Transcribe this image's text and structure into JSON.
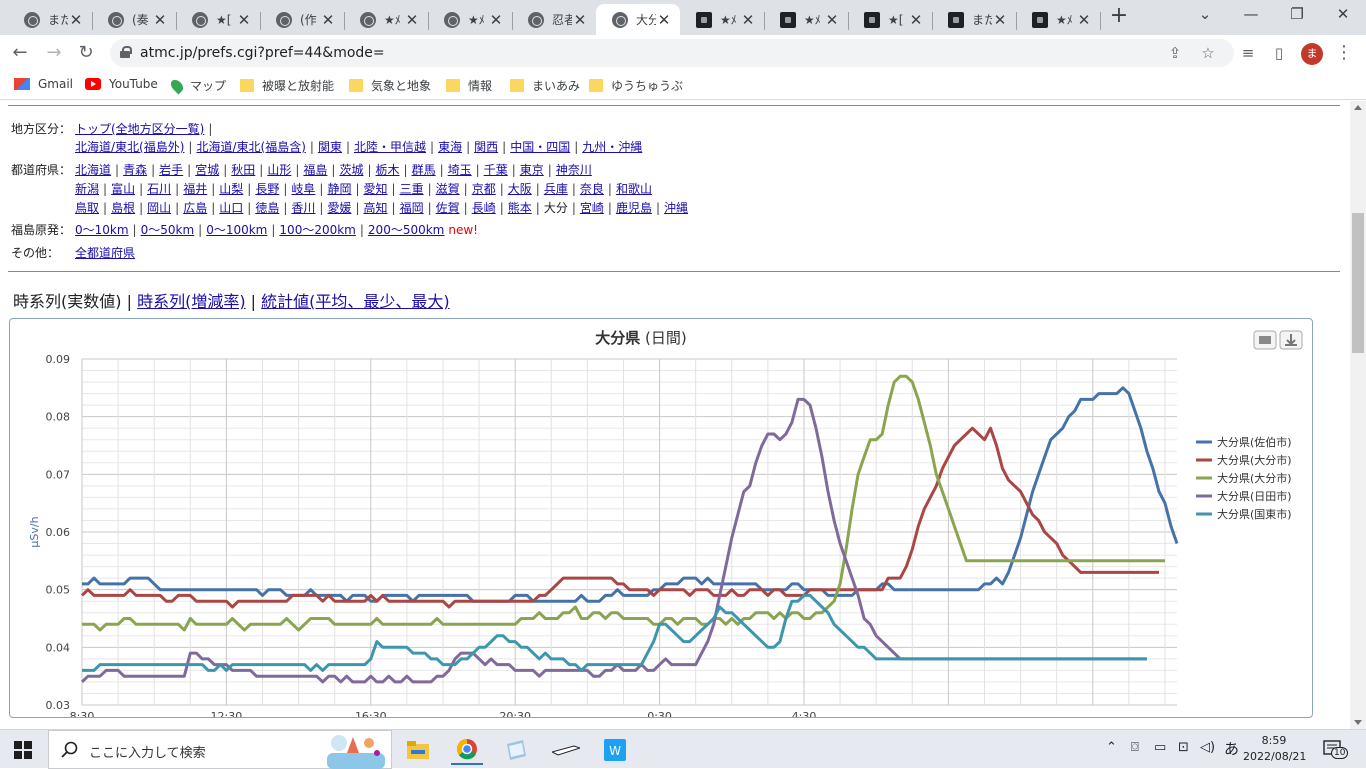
{
  "tabs": [
    {
      "title": "また",
      "icon": "globe"
    },
    {
      "title": "(奏",
      "icon": "globe"
    },
    {
      "title": "★[",
      "icon": "globe"
    },
    {
      "title": "(作",
      "icon": "globe"
    },
    {
      "title": "★ﾒ",
      "icon": "globe"
    },
    {
      "title": "★ﾒ",
      "icon": "globe"
    },
    {
      "title": "忍者",
      "icon": "globe"
    },
    {
      "title": "大分",
      "icon": "globe",
      "active": true
    },
    {
      "title": "★ﾒ",
      "icon": "site"
    },
    {
      "title": "★ﾒ",
      "icon": "site"
    },
    {
      "title": "★[",
      "icon": "site"
    },
    {
      "title": "また",
      "icon": "site"
    },
    {
      "title": "★ﾒ",
      "icon": "site"
    }
  ],
  "new_tab": "+",
  "window": {
    "minimize": "⌄",
    "restore": "—",
    "maximize": "❐",
    "close": "✕"
  },
  "toolbar": {
    "back": "←",
    "forward": "→",
    "reload": "↻",
    "url": "atmc.jp/prefs.cgi?pref=44&mode=",
    "share": "⇪",
    "star": "☆",
    "media": "≡",
    "sidepanel": "▯",
    "menu": "⋮",
    "avatar": "ま"
  },
  "bookmarks": [
    {
      "label": "Gmail",
      "type": "gmail"
    },
    {
      "label": "YouTube",
      "type": "youtube"
    },
    {
      "label": "マップ",
      "type": "maps"
    },
    {
      "label": "被曝と放射能",
      "type": "folder"
    },
    {
      "label": "気象と地象",
      "type": "folder"
    },
    {
      "label": "情報",
      "type": "folder"
    },
    {
      "label": "まいあみ",
      "type": "folder"
    },
    {
      "label": "ゆうちゅうぶ",
      "type": "folder"
    }
  ],
  "nav": {
    "region_label": "地方区分：",
    "region_top": "トップ(全地方区分一覧)",
    "regions_row1": [
      "北海道/東北(福島外)",
      "北海道/東北(福島含)",
      "関東",
      "北陸・甲信越",
      "東海",
      "関西",
      "中国・四国",
      "九州・沖縄"
    ],
    "pref_label": "都道府県：",
    "prefs_row1": [
      "北海道",
      "青森",
      "岩手",
      "宮城",
      "秋田",
      "山形",
      "福島",
      "茨城",
      "栃木",
      "群馬",
      "埼玉",
      "千葉",
      "東京",
      "神奈川"
    ],
    "prefs_row2": [
      "新潟",
      "富山",
      "石川",
      "福井",
      "山梨",
      "長野",
      "岐阜",
      "静岡",
      "愛知",
      "三重",
      "滋賀",
      "京都",
      "大阪",
      "兵庫",
      "奈良",
      "和歌山"
    ],
    "prefs_row3": [
      "鳥取",
      "島根",
      "岡山",
      "広島",
      "山口",
      "徳島",
      "香川",
      "愛媛",
      "高知",
      "福岡",
      "佐賀",
      "長崎",
      "熊本",
      "大分",
      "宮崎",
      "鹿児島",
      "沖縄"
    ],
    "current_pref": "大分",
    "fukushima_label": "福島原発：",
    "fukushima_links": [
      "0〜10km",
      "0〜50km",
      "0〜100km",
      "100〜200km",
      "200〜500km"
    ],
    "new_tag": "new!",
    "other_label": "その他：",
    "other_link": "全都道府県"
  },
  "view_tabs": {
    "current": "時系列(実数値)",
    "link1": "時系列(増減率)",
    "link2": "統計値(平均、最少、最大)",
    "sep": "|"
  },
  "chart_data": {
    "type": "line",
    "title": "大分県",
    "subtitle": "(日間)",
    "ylabel": "μSv/h",
    "ylim": [
      0.03,
      0.09
    ],
    "yticks": [
      "0.03",
      "0.04",
      "0.05",
      "0.06",
      "0.07",
      "0.08",
      "0.09"
    ],
    "xlabels": [
      "8:30",
      "12:30",
      "16:30",
      "20:30",
      "0:30",
      "4:30"
    ],
    "x_start": "8:30",
    "interval_minutes": 10,
    "legend_position": "right",
    "grid": true,
    "series": [
      {
        "name": "大分県(佐伯市)",
        "color": "#4572a7",
        "values": [
          0.051,
          0.051,
          0.052,
          0.051,
          0.051,
          0.051,
          0.051,
          0.051,
          0.052,
          0.052,
          0.052,
          0.052,
          0.051,
          0.05,
          0.05,
          0.05,
          0.05,
          0.05,
          0.05,
          0.05,
          0.05,
          0.05,
          0.05,
          0.05,
          0.05,
          0.05,
          0.05,
          0.05,
          0.05,
          0.05,
          0.049,
          0.05,
          0.05,
          0.05,
          0.049,
          0.049,
          0.049,
          0.049,
          0.05,
          0.049,
          0.049,
          0.049,
          0.049,
          0.049,
          0.048,
          0.049,
          0.049,
          0.049,
          0.048,
          0.048,
          0.049,
          0.049,
          0.049,
          0.049,
          0.049,
          0.048,
          0.049,
          0.049,
          0.049,
          0.049,
          0.049,
          0.049,
          0.049,
          0.049,
          0.049,
          0.048,
          0.048,
          0.048,
          0.048,
          0.048,
          0.048,
          0.048,
          0.049,
          0.049,
          0.049,
          0.048,
          0.048,
          0.048,
          0.048,
          0.048,
          0.048,
          0.048,
          0.048,
          0.049,
          0.048,
          0.048,
          0.048,
          0.049,
          0.049,
          0.05,
          0.049,
          0.049,
          0.049,
          0.049,
          0.049,
          0.05,
          0.05,
          0.051,
          0.051,
          0.051,
          0.052,
          0.052,
          0.052,
          0.051,
          0.052,
          0.051,
          0.051,
          0.051,
          0.051,
          0.051,
          0.051,
          0.051,
          0.051,
          0.05,
          0.05,
          0.05,
          0.05,
          0.05,
          0.051,
          0.051,
          0.05,
          0.05,
          0.05,
          0.05,
          0.049,
          0.049,
          0.049,
          0.049,
          0.049,
          0.05,
          0.05,
          0.05,
          0.05,
          0.051,
          0.051,
          0.05,
          0.05,
          0.05,
          0.05,
          0.05,
          0.05,
          0.05,
          0.05,
          0.05,
          0.05,
          0.05,
          0.05,
          0.05,
          0.05,
          0.05,
          0.051,
          0.051,
          0.052,
          0.051,
          0.053,
          0.056,
          0.059,
          0.063,
          0.067,
          0.07,
          0.073,
          0.076,
          0.077,
          0.078,
          0.08,
          0.081,
          0.083,
          0.083,
          0.083,
          0.084,
          0.084,
          0.084,
          0.084,
          0.085,
          0.084,
          0.081,
          0.078,
          0.074,
          0.071,
          0.067,
          0.065,
          0.061,
          0.058
        ]
      },
      {
        "name": "大分県(大分市)",
        "color": "#aa4643",
        "values": [
          0.049,
          0.05,
          0.049,
          0.049,
          0.049,
          0.049,
          0.049,
          0.049,
          0.05,
          0.049,
          0.049,
          0.049,
          0.049,
          0.049,
          0.048,
          0.048,
          0.049,
          0.049,
          0.049,
          0.048,
          0.048,
          0.048,
          0.048,
          0.048,
          0.048,
          0.047,
          0.048,
          0.048,
          0.048,
          0.048,
          0.048,
          0.048,
          0.048,
          0.048,
          0.048,
          0.049,
          0.049,
          0.049,
          0.049,
          0.049,
          0.048,
          0.049,
          0.048,
          0.048,
          0.048,
          0.048,
          0.048,
          0.048,
          0.049,
          0.048,
          0.049,
          0.048,
          0.048,
          0.048,
          0.048,
          0.048,
          0.048,
          0.048,
          0.048,
          0.048,
          0.048,
          0.047,
          0.048,
          0.048,
          0.048,
          0.048,
          0.048,
          0.048,
          0.048,
          0.048,
          0.048,
          0.048,
          0.048,
          0.048,
          0.048,
          0.048,
          0.049,
          0.049,
          0.05,
          0.051,
          0.052,
          0.052,
          0.052,
          0.052,
          0.052,
          0.052,
          0.052,
          0.052,
          0.052,
          0.051,
          0.051,
          0.05,
          0.05,
          0.05,
          0.05,
          0.049,
          0.05,
          0.05,
          0.05,
          0.05,
          0.05,
          0.049,
          0.05,
          0.05,
          0.05,
          0.049,
          0.049,
          0.049,
          0.05,
          0.049,
          0.049,
          0.05,
          0.05,
          0.05,
          0.049,
          0.05,
          0.05,
          0.049,
          0.049,
          0.049,
          0.049,
          0.05,
          0.05,
          0.05,
          0.05,
          0.05,
          0.05,
          0.05,
          0.05,
          0.05,
          0.05,
          0.05,
          0.05,
          0.05,
          0.052,
          0.052,
          0.052,
          0.054,
          0.057,
          0.061,
          0.064,
          0.066,
          0.068,
          0.071,
          0.073,
          0.075,
          0.076,
          0.077,
          0.078,
          0.077,
          0.076,
          0.078,
          0.075,
          0.071,
          0.069,
          0.068,
          0.067,
          0.065,
          0.063,
          0.062,
          0.06,
          0.059,
          0.058,
          0.056,
          0.055,
          0.054,
          0.053,
          0.053,
          0.053,
          0.053,
          0.053,
          0.053,
          0.053,
          0.053,
          0.053,
          0.053,
          0.053,
          0.053,
          0.053,
          0.053
        ]
      },
      {
        "name": "大分県(大分市)",
        "color": "#89a54e",
        "values": [
          0.044,
          0.044,
          0.044,
          0.043,
          0.044,
          0.044,
          0.044,
          0.045,
          0.045,
          0.044,
          0.044,
          0.044,
          0.044,
          0.044,
          0.044,
          0.044,
          0.044,
          0.043,
          0.045,
          0.044,
          0.044,
          0.044,
          0.044,
          0.044,
          0.044,
          0.045,
          0.044,
          0.043,
          0.044,
          0.044,
          0.044,
          0.044,
          0.044,
          0.044,
          0.045,
          0.044,
          0.043,
          0.044,
          0.045,
          0.045,
          0.045,
          0.045,
          0.044,
          0.044,
          0.044,
          0.044,
          0.044,
          0.044,
          0.044,
          0.045,
          0.044,
          0.044,
          0.044,
          0.044,
          0.044,
          0.044,
          0.044,
          0.044,
          0.044,
          0.045,
          0.044,
          0.044,
          0.044,
          0.044,
          0.044,
          0.044,
          0.044,
          0.044,
          0.044,
          0.044,
          0.044,
          0.044,
          0.044,
          0.045,
          0.045,
          0.045,
          0.046,
          0.045,
          0.045,
          0.045,
          0.046,
          0.046,
          0.047,
          0.045,
          0.045,
          0.046,
          0.046,
          0.045,
          0.046,
          0.046,
          0.045,
          0.045,
          0.045,
          0.045,
          0.045,
          0.044,
          0.044,
          0.045,
          0.045,
          0.044,
          0.045,
          0.045,
          0.045,
          0.044,
          0.044,
          0.045,
          0.045,
          0.044,
          0.045,
          0.044,
          0.045,
          0.045,
          0.046,
          0.046,
          0.046,
          0.045,
          0.046,
          0.045,
          0.046,
          0.046,
          0.045,
          0.045,
          0.046,
          0.046,
          0.047,
          0.048,
          0.051,
          0.057,
          0.064,
          0.07,
          0.073,
          0.076,
          0.076,
          0.077,
          0.082,
          0.086,
          0.087,
          0.087,
          0.086,
          0.083,
          0.079,
          0.075,
          0.07,
          0.067,
          0.064,
          0.061,
          0.058,
          0.055,
          0.055,
          0.055,
          0.055,
          0.055,
          0.055,
          0.055,
          0.055,
          0.055,
          0.055,
          0.055,
          0.055,
          0.055,
          0.055,
          0.055,
          0.055,
          0.055,
          0.055,
          0.055,
          0.055,
          0.055,
          0.055,
          0.055,
          0.055,
          0.055,
          0.055,
          0.055,
          0.055,
          0.055,
          0.055,
          0.055,
          0.055,
          0.055,
          0.055
        ]
      },
      {
        "name": "大分県(日田市)",
        "color": "#80699b",
        "values": [
          0.034,
          0.035,
          0.035,
          0.035,
          0.036,
          0.036,
          0.036,
          0.035,
          0.035,
          0.035,
          0.035,
          0.035,
          0.035,
          0.035,
          0.035,
          0.035,
          0.035,
          0.035,
          0.039,
          0.039,
          0.038,
          0.038,
          0.037,
          0.037,
          0.037,
          0.036,
          0.036,
          0.036,
          0.036,
          0.035,
          0.035,
          0.035,
          0.035,
          0.035,
          0.035,
          0.035,
          0.035,
          0.035,
          0.035,
          0.035,
          0.034,
          0.035,
          0.035,
          0.034,
          0.035,
          0.034,
          0.034,
          0.034,
          0.035,
          0.034,
          0.034,
          0.035,
          0.034,
          0.034,
          0.035,
          0.034,
          0.034,
          0.034,
          0.034,
          0.035,
          0.035,
          0.036,
          0.038,
          0.039,
          0.039,
          0.039,
          0.038,
          0.037,
          0.038,
          0.037,
          0.037,
          0.037,
          0.036,
          0.036,
          0.036,
          0.036,
          0.035,
          0.036,
          0.036,
          0.036,
          0.036,
          0.036,
          0.036,
          0.036,
          0.036,
          0.035,
          0.035,
          0.036,
          0.036,
          0.037,
          0.036,
          0.036,
          0.036,
          0.037,
          0.036,
          0.036,
          0.037,
          0.038,
          0.037,
          0.037,
          0.037,
          0.037,
          0.037,
          0.039,
          0.041,
          0.044,
          0.049,
          0.054,
          0.059,
          0.063,
          0.067,
          0.068,
          0.072,
          0.075,
          0.077,
          0.077,
          0.076,
          0.077,
          0.079,
          0.083,
          0.083,
          0.082,
          0.078,
          0.073,
          0.067,
          0.062,
          0.058,
          0.055,
          0.052,
          0.049,
          0.045,
          0.044,
          0.042,
          0.041,
          0.04,
          0.039,
          0.038,
          0.038,
          0.038,
          0.038,
          0.038,
          0.038,
          0.038,
          0.038,
          0.038,
          0.038,
          0.038,
          0.038,
          0.038,
          0.038,
          0.038,
          0.038,
          0.038,
          0.038,
          0.038,
          0.038,
          0.038,
          0.038,
          0.038,
          0.038,
          0.038,
          0.038,
          0.038,
          0.038,
          0.038,
          0.038,
          0.038,
          0.038,
          0.038,
          0.038,
          0.038,
          0.038,
          0.038,
          0.038,
          0.038,
          0.038,
          0.038,
          0.038
        ]
      },
      {
        "name": "大分県(国東市)",
        "color": "#3d96ae",
        "values": [
          0.036,
          0.036,
          0.036,
          0.037,
          0.037,
          0.037,
          0.037,
          0.037,
          0.037,
          0.037,
          0.037,
          0.037,
          0.037,
          0.037,
          0.037,
          0.037,
          0.037,
          0.037,
          0.037,
          0.037,
          0.037,
          0.036,
          0.036,
          0.037,
          0.036,
          0.037,
          0.037,
          0.037,
          0.037,
          0.037,
          0.037,
          0.037,
          0.037,
          0.037,
          0.037,
          0.037,
          0.037,
          0.037,
          0.036,
          0.037,
          0.036,
          0.037,
          0.037,
          0.037,
          0.037,
          0.037,
          0.037,
          0.037,
          0.038,
          0.041,
          0.04,
          0.04,
          0.04,
          0.04,
          0.04,
          0.039,
          0.039,
          0.039,
          0.038,
          0.038,
          0.037,
          0.037,
          0.037,
          0.038,
          0.038,
          0.039,
          0.04,
          0.04,
          0.041,
          0.042,
          0.042,
          0.041,
          0.041,
          0.04,
          0.04,
          0.039,
          0.038,
          0.039,
          0.038,
          0.038,
          0.038,
          0.037,
          0.037,
          0.036,
          0.037,
          0.037,
          0.037,
          0.037,
          0.037,
          0.037,
          0.037,
          0.037,
          0.037,
          0.037,
          0.039,
          0.041,
          0.044,
          0.044,
          0.043,
          0.042,
          0.041,
          0.041,
          0.042,
          0.043,
          0.044,
          0.045,
          0.047,
          0.046,
          0.046,
          0.045,
          0.044,
          0.043,
          0.042,
          0.041,
          0.04,
          0.04,
          0.041,
          0.045,
          0.048,
          0.048,
          0.049,
          0.049,
          0.048,
          0.047,
          0.046,
          0.044,
          0.043,
          0.042,
          0.041,
          0.04,
          0.04,
          0.039,
          0.038,
          0.038,
          0.038,
          0.038,
          0.038,
          0.038,
          0.038,
          0.038,
          0.038,
          0.038,
          0.038,
          0.038,
          0.038,
          0.038,
          0.038,
          0.038,
          0.038,
          0.038,
          0.038,
          0.038,
          0.038,
          0.038,
          0.038,
          0.038,
          0.038,
          0.038,
          0.038,
          0.038,
          0.038,
          0.038,
          0.038,
          0.038,
          0.038,
          0.038,
          0.038,
          0.038,
          0.038,
          0.038,
          0.038,
          0.038,
          0.038,
          0.038,
          0.038,
          0.038,
          0.038,
          0.038
        ]
      }
    ]
  },
  "taskbar": {
    "search_placeholder": "ここに入力して検索",
    "time": "8:59",
    "date": "2022/08/21",
    "ime": "あ",
    "notifications": "10"
  }
}
